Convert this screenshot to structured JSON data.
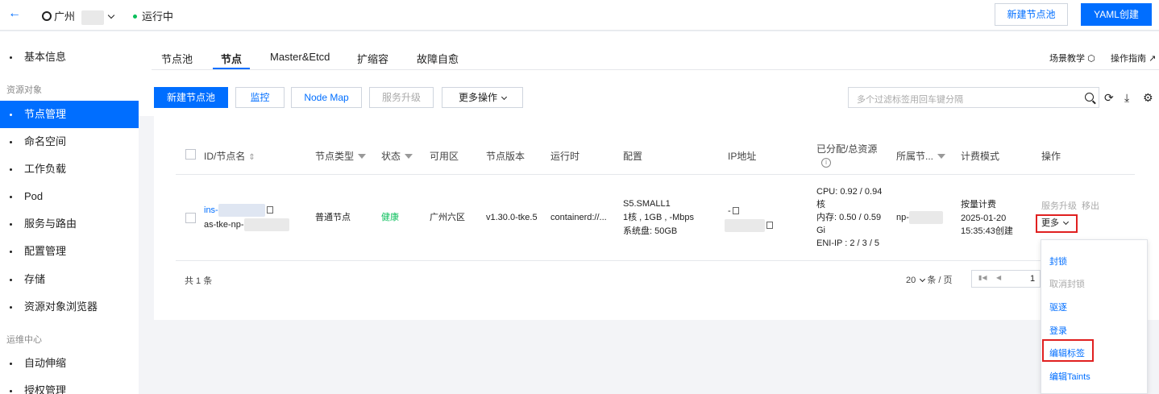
{
  "topbar": {
    "back_icon": "←",
    "region": "广州",
    "status": "运行中",
    "new_pool_button": "新建节点池",
    "yaml_button": "YAML创建"
  },
  "sidebar": {
    "items": [
      {
        "label": "基本信息"
      },
      {
        "group": "资源对象"
      },
      {
        "label": "节点管理",
        "active": true
      },
      {
        "label": "命名空间"
      },
      {
        "label": "工作负载"
      },
      {
        "label": "Pod"
      },
      {
        "label": "服务与路由"
      },
      {
        "label": "配置管理"
      },
      {
        "label": "存储"
      },
      {
        "label": "资源对象浏览器"
      },
      {
        "group": "运维中心"
      },
      {
        "label": "自动伸缩"
      },
      {
        "label": "授权管理"
      }
    ]
  },
  "tabs": [
    "节点池",
    "节点",
    "Master&Etcd",
    "扩缩容",
    "故障自愈"
  ],
  "top_links": {
    "scene": "场景教学",
    "guide": "操作指南"
  },
  "toolbar": {
    "new_pool": "新建节点池",
    "monitor": "监控",
    "node_map": "Node Map",
    "upgrade": "服务升级",
    "more_ops": "更多操作",
    "search_placeholder": "多个过滤标签用回车键分隔"
  },
  "table": {
    "headers": [
      "ID/节点名",
      "节点类型",
      "状态",
      "可用区",
      "节点版本",
      "运行时",
      "配置",
      "IP地址",
      "已分配/总资源",
      "所属节...",
      "计费模式",
      "操作"
    ],
    "rows": [
      {
        "id": "ins-",
        "name": "as-tke-np-",
        "type": "普通节点",
        "status": "健康",
        "zone": "广州六区",
        "version": "v1.30.0-tke.5",
        "runtime": "containerd://...",
        "config_1": "S5.SMALL1",
        "config_2": "1核 , 1GB , -Mbps",
        "config_3": "系统盘: 50GB",
        "ip": "-",
        "res_1": "CPU: 0.92 / 0.94",
        "res_2": "核",
        "res_3": "内存: 0.50 / 0.59",
        "res_4": "Gi",
        "res_5": "ENI-IP : 2 / 3 / 5",
        "pool": "np-",
        "billing": "按量计费",
        "billing_date": "2025-01-20",
        "billing_time": "15:35:43创建",
        "op_upgrade": "服务升级",
        "op_remove": "移出",
        "op_more": "更多"
      }
    ]
  },
  "dropdown": [
    "封锁",
    "取消封锁",
    "驱逐",
    "登录",
    "编辑标签",
    "编辑Taints"
  ],
  "footer": {
    "total": "共 1 条",
    "page_size": "20",
    "per_page": "条 / 页",
    "page": "1"
  },
  "colors": {
    "accent": "#006eff",
    "healthy": "#0abf5b",
    "highlight": "#e02020"
  }
}
